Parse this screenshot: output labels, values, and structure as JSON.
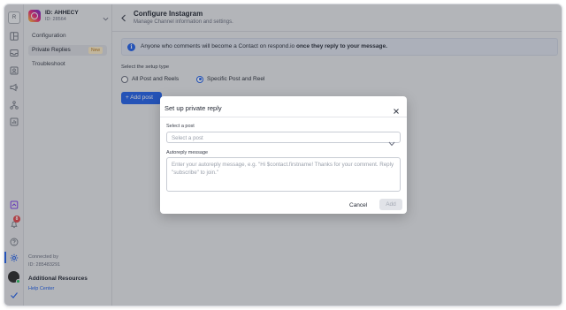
{
  "rail": {
    "top_letter": "R",
    "notification_count": "8",
    "icons": [
      "layout-icon",
      "inbox-icon",
      "contacts-icon",
      "broadcast-icon",
      "workflow-icon",
      "reports-icon",
      "reports-2-icon",
      "notification-icon",
      "help-icon",
      "settings-icon",
      "checkmark-icon"
    ]
  },
  "sidebar": {
    "channel_name": "ID: AHHECY",
    "channel_sub": "ID: 28564",
    "items": [
      {
        "label": "Configuration"
      },
      {
        "label": "Private Replies",
        "tag": "New"
      },
      {
        "label": "Troubleshoot"
      }
    ],
    "footer": {
      "connected_by": "Connected by",
      "connected_id": "ID: 285483291",
      "resources": "Additional Resources",
      "help": "Help Center"
    }
  },
  "main": {
    "title": "Configure Instagram",
    "subtitle": "Manage Channel information and settings.",
    "banner": {
      "text_plain": "Anyone who comments will become a Contact on respond.io",
      "text_bold": "once they reply to your message."
    },
    "setup_label": "Select the setup type",
    "options": [
      {
        "label": "All Post and Reels",
        "selected": false
      },
      {
        "label": "Specific Post and Reel",
        "selected": true
      }
    ],
    "add_post_label": "Add post"
  },
  "modal": {
    "title": "Set up private reply",
    "post_label": "Select a post",
    "post_placeholder": "Select a post",
    "message_label": "Autoreply message",
    "message_placeholder": "Enter your autoreply message, e.g. \"Hi $contact.firstname! Thanks for your comment. Reply \"subscribe\" to join.\"",
    "cancel_label": "Cancel",
    "add_label": "Add"
  },
  "colors": {
    "accent": "#2563eb",
    "badge": "#e5484d",
    "new_tag": "#fcecc8"
  }
}
